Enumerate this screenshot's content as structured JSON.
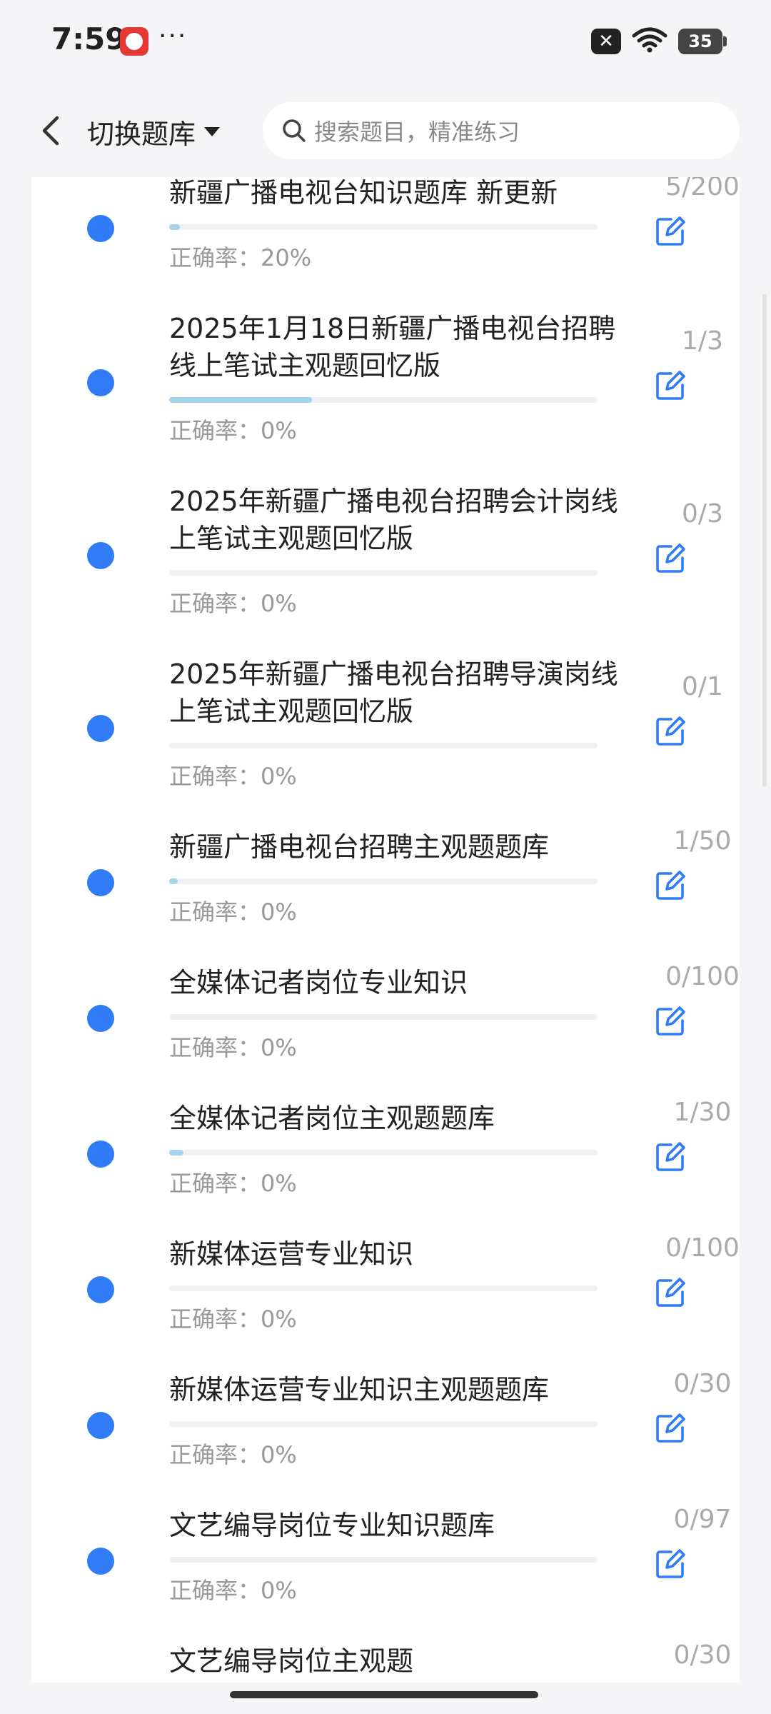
{
  "status_bar": {
    "time": "7:59",
    "dots": "···",
    "battery": "35",
    "x_badge": "✕"
  },
  "header": {
    "back_icon": "chevron-left-icon",
    "switch_label": "切换题库",
    "search_placeholder": "搜索题目，精准练习"
  },
  "colors": {
    "accent": "#2f7cf6",
    "progress_fill": "#a7d3ec",
    "muted_text": "#999999"
  },
  "rows": [
    {
      "title": "新疆广播电视台知识题库 新更新",
      "count": "5/200",
      "rate": "正确率：20%",
      "progress": 0.025
    },
    {
      "title": "2025年1月18日新疆广播电视台招聘线上笔试主观题回忆版",
      "count": "1/3",
      "rate": "正确率：0%",
      "progress": 0.333
    },
    {
      "title": "2025年新疆广播电视台招聘会计岗线上笔试主观题回忆版",
      "count": "0/3",
      "rate": "正确率：0%",
      "progress": 0
    },
    {
      "title": "2025年新疆广播电视台招聘导演岗线上笔试主观题回忆版",
      "count": "0/1",
      "rate": "正确率：0%",
      "progress": 0
    },
    {
      "title": "新疆广播电视台招聘主观题题库",
      "count": "1/50",
      "rate": "正确率：0%",
      "progress": 0.02
    },
    {
      "title": "全媒体记者岗位专业知识",
      "count": "0/100",
      "rate": "正确率：0%",
      "progress": 0
    },
    {
      "title": "全媒体记者岗位主观题题库",
      "count": "1/30",
      "rate": "正确率：0%",
      "progress": 0.033
    },
    {
      "title": "新媒体运营专业知识",
      "count": "0/100",
      "rate": "正确率：0%",
      "progress": 0
    },
    {
      "title": "新媒体运营专业知识主观题题库",
      "count": "0/30",
      "rate": "正确率：0%",
      "progress": 0
    },
    {
      "title": "文艺编导岗位专业知识题库",
      "count": "0/97",
      "rate": "正确率：0%",
      "progress": 0
    },
    {
      "title": "文艺编导岗位主观题",
      "count": "0/30",
      "rate": "",
      "progress": 0
    }
  ]
}
